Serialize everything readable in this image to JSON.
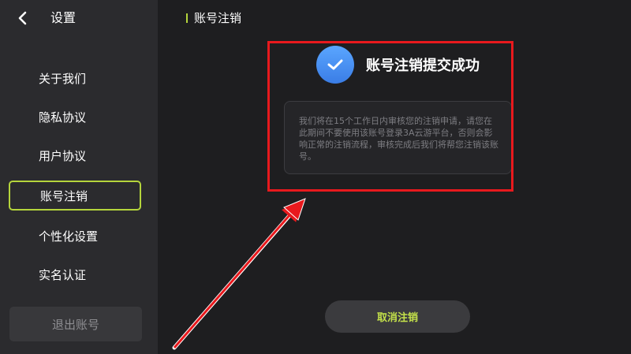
{
  "sidebar": {
    "title": "设置",
    "items": [
      {
        "label": "关于我们"
      },
      {
        "label": "隐私协议"
      },
      {
        "label": "用户协议"
      },
      {
        "label": "账号注销"
      },
      {
        "label": "个性化设置"
      },
      {
        "label": "实名认证"
      }
    ],
    "logout_label": "退出账号"
  },
  "header": {
    "title": "账号注销"
  },
  "main": {
    "success_title": "账号注销提交成功",
    "notice_text": "我们将在15个工作日内审核您的注销申请，请您在此期间不要使用该账号登录3A云游平台，否则会影响正常的注销流程，审核完成后我们将帮您注销该账号。",
    "cancel_label": "取消注销"
  },
  "colors": {
    "accent": "#b5d53c",
    "annotation_red": "#e8191d",
    "check_blue": "#4a90f2"
  },
  "icons": {
    "back": "chevron-left-icon",
    "success": "check-circle-icon"
  }
}
